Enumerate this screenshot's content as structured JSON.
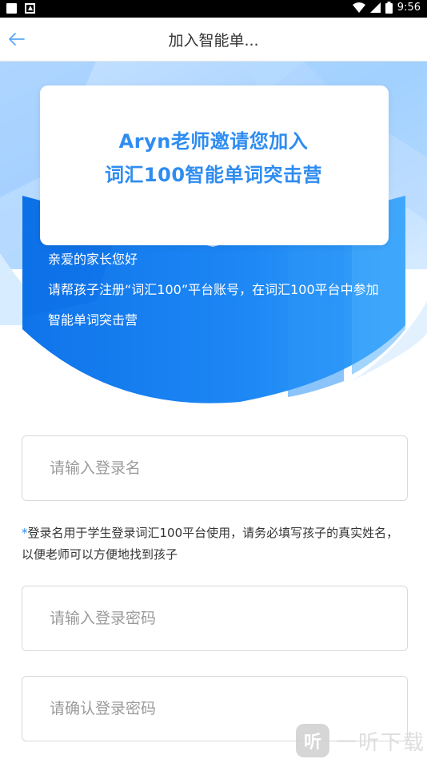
{
  "status_bar": {
    "time": "9:56",
    "icons": [
      "notification-square-icon",
      "app-store-icon",
      "wifi-icon",
      "signal-icon",
      "battery-icon"
    ]
  },
  "header": {
    "back_icon": "arrow-left-icon",
    "title": "加入智能单..."
  },
  "banner": {
    "invite_line_1": "Aryn老师邀请您加入",
    "invite_line_2": "词汇100智能单词突击营",
    "greeting": "亲爱的家长您好",
    "description": "请帮孩子注册“词汇100”平台账号，在词汇100平台中参加智能单词突击营"
  },
  "form": {
    "login_name": {
      "value": "",
      "placeholder": "请输入登录名"
    },
    "hint_star": "*",
    "hint_text": "登录名用于学生登录词汇100平台使用，请务必填写孩子的真实姓名，以便老师可以方便地找到孩子",
    "password": {
      "value": "",
      "placeholder": "请输入登录密码"
    },
    "confirm_password": {
      "value": "",
      "placeholder": "请确认登录密码"
    }
  },
  "watermark": {
    "badge": "听",
    "text": "一听下载"
  },
  "colors": {
    "accent": "#2f8cf0",
    "banner_blue": "#1e88f5",
    "banner_light": "#bfe0ff"
  }
}
